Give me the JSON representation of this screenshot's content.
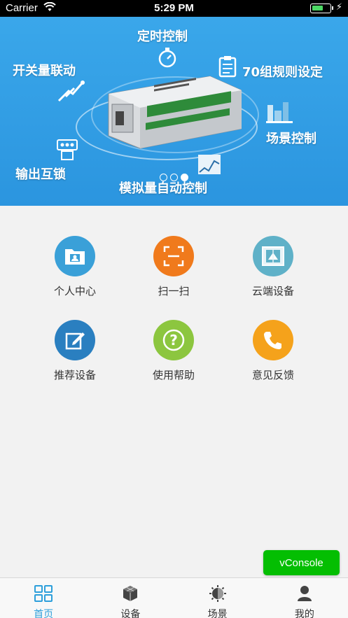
{
  "status_bar": {
    "carrier": "Carrier",
    "time": "5:29 PM"
  },
  "banner": {
    "labels": {
      "timer": "定时控制",
      "switch": "开关量联动",
      "rules": "70组规则设定",
      "scene": "场景控制",
      "interlock": "输出互锁",
      "analog": "模拟量自动控制"
    },
    "slide_count": 3,
    "active_slide": 3
  },
  "menu": [
    {
      "label": "个人中心",
      "icon": "folder-user-icon",
      "color": "#3aa0d8"
    },
    {
      "label": "扫一扫",
      "icon": "scan-icon",
      "color": "#f07a1c"
    },
    {
      "label": "云端设备",
      "icon": "cloud-device-icon",
      "color": "#5fb1c8"
    },
    {
      "label": "推荐设备",
      "icon": "edit-icon",
      "color": "#2a7fc0"
    },
    {
      "label": "使用帮助",
      "icon": "help-icon",
      "color": "#8cc63f"
    },
    {
      "label": "意见反馈",
      "icon": "phone-icon",
      "color": "#f5a21b"
    }
  ],
  "vconsole": {
    "label": "vConsole"
  },
  "tabs": [
    {
      "label": "首页",
      "icon": "grid-icon",
      "active": true
    },
    {
      "label": "设备",
      "icon": "cube-icon",
      "active": false
    },
    {
      "label": "场景",
      "icon": "scene-icon",
      "active": false
    },
    {
      "label": "我的",
      "icon": "user-icon",
      "active": false
    }
  ],
  "colors": {
    "accent": "#2d9fdb",
    "banner": "#3aa7ea",
    "vconsole": "#04be02"
  }
}
